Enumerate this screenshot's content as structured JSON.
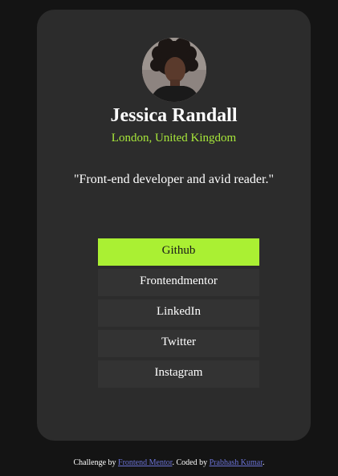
{
  "profile": {
    "name": "Jessica Randall",
    "location": "London, United Kingdom",
    "bio": "\"Front-end developer and avid reader.\""
  },
  "links": [
    {
      "label": "Github",
      "active": true
    },
    {
      "label": "Frontendmentor",
      "active": false
    },
    {
      "label": "LinkedIn",
      "active": false
    },
    {
      "label": "Twitter",
      "active": false
    },
    {
      "label": "Instagram",
      "active": false
    }
  ],
  "footer": {
    "prefix": "Challenge by ",
    "challenge_link": "Frontend Mentor",
    "middle": ". Coded by ",
    "author_link": "Prabhash Kumar",
    "suffix": "."
  },
  "colors": {
    "accent": "#aaf033",
    "location": "#a8e83a",
    "card": "#2c2c2c",
    "background": "#141414",
    "button": "#333333",
    "footer_link": "#6b73d6"
  }
}
